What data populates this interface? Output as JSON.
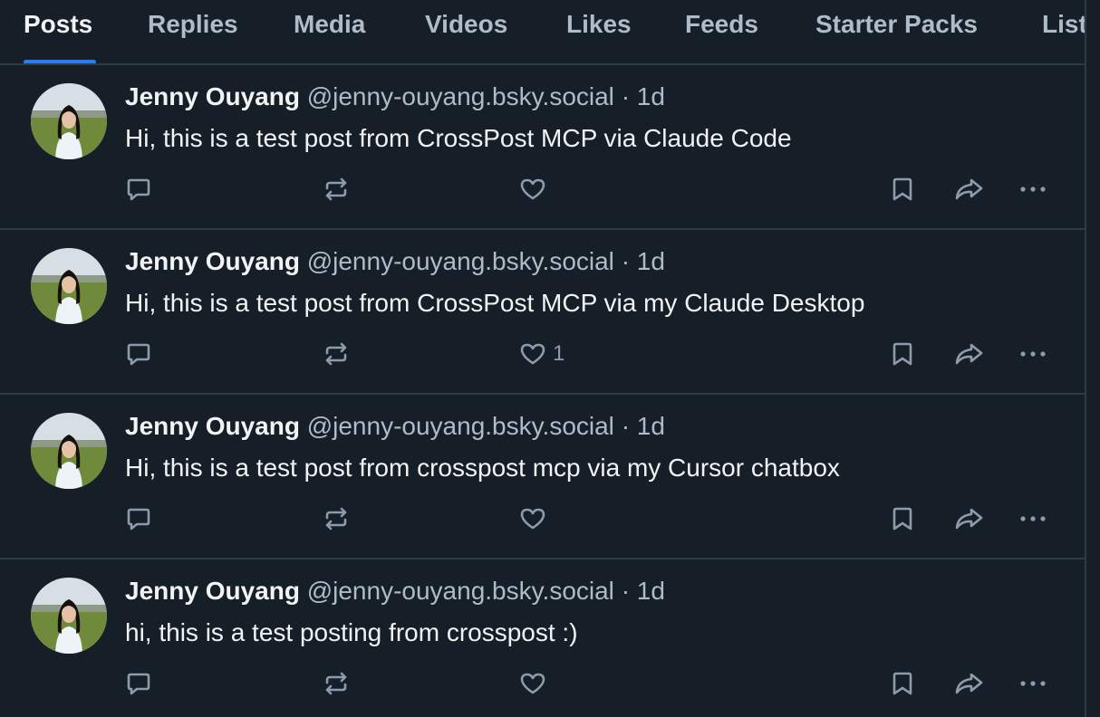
{
  "tabs": [
    {
      "label": "Posts",
      "active": true
    },
    {
      "label": "Replies",
      "active": false
    },
    {
      "label": "Media",
      "active": false
    },
    {
      "label": "Videos",
      "active": false
    },
    {
      "label": "Likes",
      "active": false
    },
    {
      "label": "Feeds",
      "active": false
    },
    {
      "label": "Starter Packs",
      "active": false
    },
    {
      "label": "Lists",
      "active": false
    }
  ],
  "colors": {
    "background": "#161e27",
    "divider": "#2e3a47",
    "primary_text": "#f1f3f5",
    "secondary_text": "#aebbc9",
    "icon": "#8c9cad",
    "accent": "#2a7ef4"
  },
  "posts": [
    {
      "author": "Jenny Ouyang",
      "handle": "@jenny-ouyang.bsky.social",
      "separator": "·",
      "time": "1d",
      "text": "Hi, this is a test post from CrossPost MCP via Claude Code",
      "like_count": ""
    },
    {
      "author": "Jenny Ouyang",
      "handle": "@jenny-ouyang.bsky.social",
      "separator": "·",
      "time": "1d",
      "text": "Hi, this is a test post from CrossPost MCP via my Claude Desktop",
      "like_count": "1"
    },
    {
      "author": "Jenny Ouyang",
      "handle": "@jenny-ouyang.bsky.social",
      "separator": "·",
      "time": "1d",
      "text": "Hi, this is a test post from crosspost mcp via my Cursor chatbox",
      "like_count": ""
    },
    {
      "author": "Jenny Ouyang",
      "handle": "@jenny-ouyang.bsky.social",
      "separator": "·",
      "time": "1d",
      "text": "hi, this is a test posting from crosspost :)",
      "like_count": ""
    }
  ],
  "icons": {
    "reply": "reply-icon",
    "repost": "repost-icon",
    "like": "heart-icon",
    "bookmark": "bookmark-icon",
    "share": "share-icon",
    "more": "more-icon"
  }
}
